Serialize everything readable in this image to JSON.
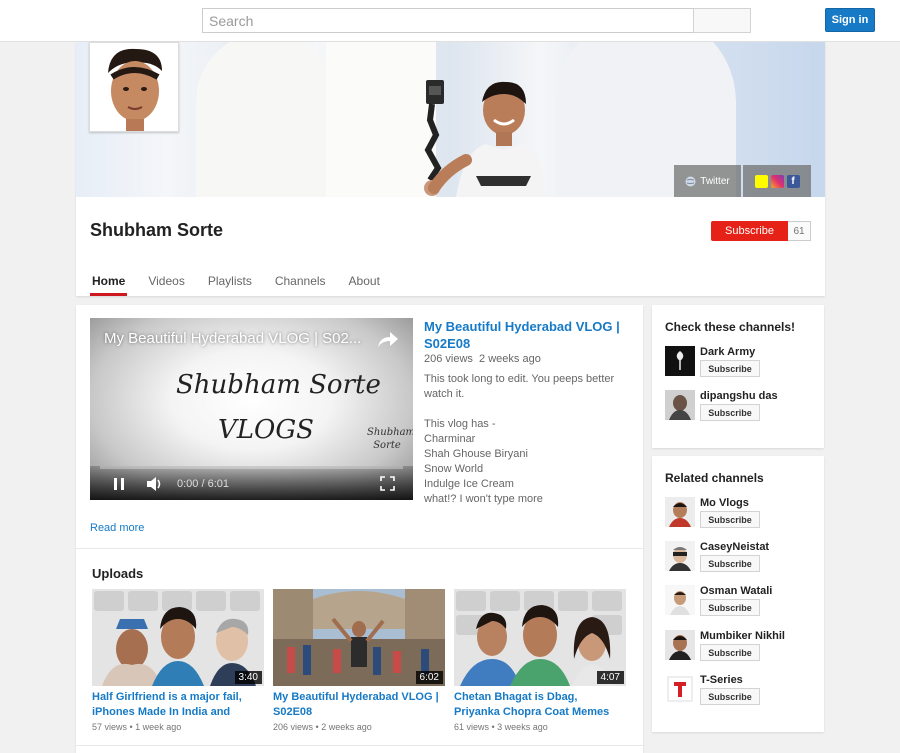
{
  "header": {
    "search_placeholder": "Search",
    "signin_label": "Sign in"
  },
  "channel": {
    "name": "Shubham Sorte",
    "subscribe_label": "Subscribe",
    "subscriber_count": "61",
    "twitter_label": "Twitter",
    "tabs": [
      {
        "label": "Home",
        "active": true
      },
      {
        "label": "Videos",
        "active": false
      },
      {
        "label": "Playlists",
        "active": false
      },
      {
        "label": "Channels",
        "active": false
      },
      {
        "label": "About",
        "active": false
      }
    ]
  },
  "featured": {
    "player_title": "My Beautiful Hyderabad VLOG | S02...",
    "thumb_text_1": "Shubham Sorte",
    "thumb_text_2": "VLOGS",
    "thumb_corner": "Shubham Sorte",
    "time": "0:00 / 6:01",
    "title": "My Beautiful Hyderabad VLOG | S02E08",
    "views": "206 views",
    "age": "2 weeks ago",
    "description": "This took long to edit. You peeps better watch it.\n\nThis vlog has -\nCharminar\nShah Ghouse Biryani\nSnow World\nIndulge Ice Cream\nwhat!? I won't type more",
    "read_more": "Read more"
  },
  "uploads": {
    "heading": "Uploads",
    "items": [
      {
        "title": "Half Girlfriend is a major fail, iPhones Made In India and",
        "views": "57 views",
        "age": "1 week ago",
        "duration": "3:40"
      },
      {
        "title": "My Beautiful Hyderabad VLOG | S02E08",
        "views": "206 views",
        "age": "2 weeks ago",
        "duration": "6:02"
      },
      {
        "title": "Chetan Bhagat is Dbag, Priyanka Chopra Coat Memes and Water",
        "views": "61 views",
        "age": "3 weeks ago",
        "duration": "4:07"
      }
    ]
  },
  "check_channels": {
    "heading": "Check these channels!",
    "items": [
      {
        "name": "Dark Army",
        "subscribe": "Subscribe"
      },
      {
        "name": "dipangshu das",
        "subscribe": "Subscribe"
      }
    ]
  },
  "related_channels": {
    "heading": "Related channels",
    "items": [
      {
        "name": "Mo Vlogs",
        "subscribe": "Subscribe"
      },
      {
        "name": "CaseyNeistat",
        "subscribe": "Subscribe"
      },
      {
        "name": "Osman Watali",
        "subscribe": "Subscribe"
      },
      {
        "name": "Mumbiker Nikhil",
        "subscribe": "Subscribe"
      },
      {
        "name": "T-Series",
        "subscribe": "Subscribe"
      }
    ]
  },
  "colors": {
    "accent_blue": "#167ac6",
    "subscribe_red": "#e62117",
    "tab_underline": "#cc181e"
  }
}
